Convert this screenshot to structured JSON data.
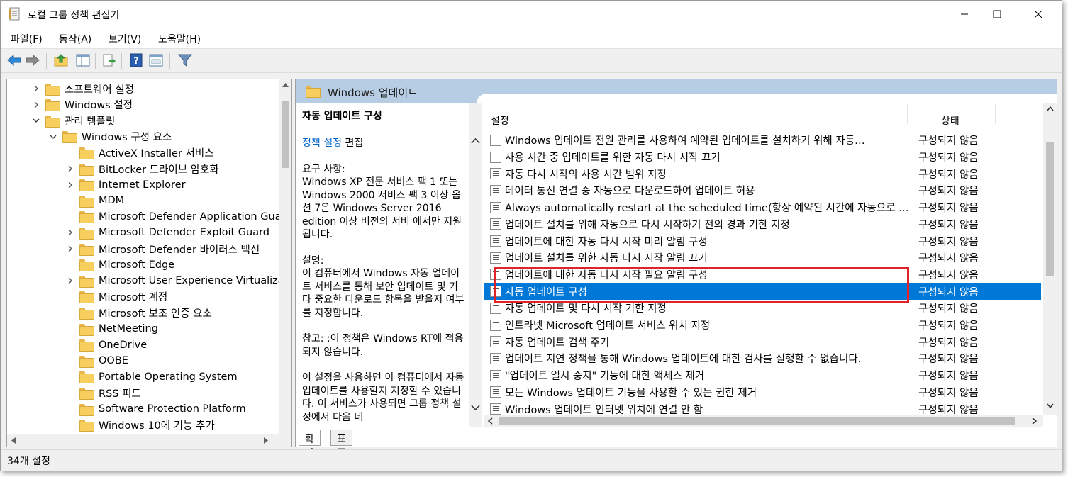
{
  "window": {
    "title": "로컬 그룹 정책 편집기"
  },
  "menu": [
    "파일(F)",
    "동작(A)",
    "보기(V)",
    "도움말(H)"
  ],
  "toolbar_icons": [
    "back-arrow-icon",
    "forward-arrow-icon",
    "up-folder-icon",
    "show-hide-tree-icon",
    "export-list-icon",
    "help-icon",
    "properties-icon",
    "filter-icon"
  ],
  "tree": [
    {
      "label": "소프트웨어 설정",
      "expander": "collapsed",
      "level": 1
    },
    {
      "label": "Windows 설정",
      "expander": "collapsed",
      "level": 1
    },
    {
      "label": "관리 템플릿",
      "expander": "expanded",
      "level": 1
    },
    {
      "label": "Windows 구성 요소",
      "expander": "expanded",
      "level": 2
    },
    {
      "label": "ActiveX Installer 서비스",
      "expander": "none",
      "level": 3
    },
    {
      "label": "BitLocker 드라이브 암호화",
      "expander": "collapsed",
      "level": 3
    },
    {
      "label": "Internet Explorer",
      "expander": "collapsed",
      "level": 3
    },
    {
      "label": "MDM",
      "expander": "none",
      "level": 3
    },
    {
      "label": "Microsoft Defender Application Guard",
      "expander": "none",
      "level": 3
    },
    {
      "label": "Microsoft Defender Exploit Guard",
      "expander": "collapsed",
      "level": 3
    },
    {
      "label": "Microsoft Defender 바이러스 백신",
      "expander": "collapsed",
      "level": 3
    },
    {
      "label": "Microsoft Edge",
      "expander": "none",
      "level": 3
    },
    {
      "label": "Microsoft User Experience Virtualizatio",
      "expander": "collapsed",
      "level": 3
    },
    {
      "label": "Microsoft 계정",
      "expander": "none",
      "level": 3
    },
    {
      "label": "Microsoft 보조 인증 요소",
      "expander": "none",
      "level": 3
    },
    {
      "label": "NetMeeting",
      "expander": "none",
      "level": 3
    },
    {
      "label": "OneDrive",
      "expander": "none",
      "level": 3
    },
    {
      "label": "OOBE",
      "expander": "none",
      "level": 3
    },
    {
      "label": "Portable Operating System",
      "expander": "none",
      "level": 3
    },
    {
      "label": "RSS 피드",
      "expander": "none",
      "level": 3
    },
    {
      "label": "Software Protection Platform",
      "expander": "none",
      "level": 3
    },
    {
      "label": "Windows 10에 기능 추가",
      "expander": "none",
      "level": 3
    }
  ],
  "details": {
    "header_title": "Windows 업데이트",
    "selected_title": "자동 업데이트 구성",
    "policy_link": "정책 설정",
    "edit_label": "편집",
    "requirements_label": "요구 사항:",
    "requirements_text": "Windows XP 전문 서비스 팩 1 또는 Windows 2000 서비스 팩 3 이상 옵션 7은 Windows Server 2016 edition 이상 버전의 서버 에서만 지원됩니다.",
    "description_label": "설명:",
    "description_text": "이 컴퓨터에서 Windows 자동 업데이트 서비스를 통해 보안 업데이트 및 기타 중요한 다운로드 항목을 받을지 여부를 지정합니다.",
    "note_text": "참고: :이 정책은 Windows RT에 적용되지 않습니다.",
    "enable_text": "이 설정을 사용하면 이 컴퓨터에서 자동 업데이트를 사용할지 지정할 수 있습니다. 이 서비스가 사용되면 그룹 정책 설정에서 다음 네"
  },
  "list": {
    "col_setting": "설정",
    "col_status": "상태",
    "rows": [
      {
        "name": "Windows 업데이트 전원 관리를 사용하여 예약된 업데이트를 설치하기 위해 자동…",
        "state": "구성되지 않음"
      },
      {
        "name": "사용 시간 중 업데이트를 위한 자동 다시 시작 끄기",
        "state": "구성되지 않음"
      },
      {
        "name": "자동 다시 시작의 사용 시간 범위 지정",
        "state": "구성되지 않음"
      },
      {
        "name": "데이터 통신 연결 중 자동으로 다운로드하여 업데이트 허용",
        "state": "구성되지 않음"
      },
      {
        "name": "Always automatically restart at the scheduled time(항상 예약된 시간에 자동으로 다…",
        "state": "구성되지 않음"
      },
      {
        "name": "업데이트 설치를 위해 자동으로 다시 시작하기 전의 경과 기한 지정",
        "state": "구성되지 않음"
      },
      {
        "name": "업데이트에 대한 자동 다시 시작 미리 알림 구성",
        "state": "구성되지 않음"
      },
      {
        "name": "업데이트 설치를 위한 자동 다시 시작 알림 끄기",
        "state": "구성되지 않음"
      },
      {
        "name": "업데이트에 대한 자동 다시 시작 필요 알림 구성",
        "state": "구성되지 않음"
      },
      {
        "name": "자동 업데이트 구성",
        "state": "구성되지 않음",
        "selected": true
      },
      {
        "name": "자동 업데이트 및 다시 시작 기한 지정",
        "state": "구성되지 않음"
      },
      {
        "name": "인트라넷 Microsoft 업데이트 서비스 위치 지정",
        "state": "구성되지 않음"
      },
      {
        "name": "자동 업데이트 검색 주기",
        "state": "구성되지 않음"
      },
      {
        "name": "업데이트 지연 정책을 통해 Windows 업데이트에 대한 검사를 실행할 수 없습니다.",
        "state": "구성되지 않음"
      },
      {
        "name": "\"업데이트 일시 중지\" 기능에 대한 액세스 제거",
        "state": "구성되지 않음"
      },
      {
        "name": "모든 Windows 업데이트 기능을 사용할 수 있는 권한 제거",
        "state": "구성되지 않음"
      },
      {
        "name": "Windows 업데이트 인터넷 위치에 연결 안 함",
        "state": "구성되지 않음"
      }
    ]
  },
  "tabs": [
    "확장",
    "표준"
  ],
  "status": {
    "count_text": "34개 설정"
  },
  "colors": {
    "selection": "#0078d7",
    "highlight_box": "#e0232a",
    "header_band": "#b7cde3"
  }
}
